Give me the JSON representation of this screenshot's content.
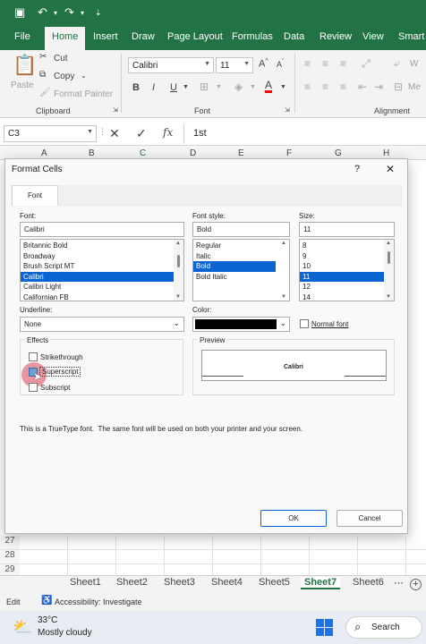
{
  "qat": {
    "save_icon": "save-icon",
    "undo_icon": "undo-icon",
    "redo_icon": "redo-icon"
  },
  "ribbon_tabs": [
    "File",
    "Home",
    "Insert",
    "Draw",
    "Page Layout",
    "Formulas",
    "Data",
    "Review",
    "View",
    "Smart W"
  ],
  "clipboard": {
    "paste": "Paste",
    "cut": "Cut",
    "copy": "Copy",
    "format_painter": "Format Painter",
    "group": "Clipboard"
  },
  "font_group": {
    "font_name": "Calibri",
    "font_size": "11",
    "bold": "B",
    "italic": "I",
    "underline": "U",
    "font_color_letter": "A",
    "group": "Font",
    "font_color": "#ff0000"
  },
  "alignment_group": {
    "wrap": "W",
    "merge": "Me",
    "group": "Alignment"
  },
  "formula_bar": {
    "name_box": "C3",
    "fx": "fx",
    "value": "1st"
  },
  "columns": [
    "A",
    "B",
    "C",
    "D",
    "E",
    "F",
    "G",
    "H"
  ],
  "rows": [
    "27",
    "28",
    "29"
  ],
  "dialog": {
    "title": "Format Cells",
    "help": "?",
    "close": "✕",
    "tab": "Font",
    "font_label": "Font:",
    "font_value": "Calibri",
    "font_list": [
      "Britannic Bold",
      "Broadway",
      "Brush Script MT",
      "Calibri",
      "Calibri Light",
      "Californian FB"
    ],
    "font_selected": "Calibri",
    "style_label": "Font style:",
    "style_value": "Bold",
    "style_list": [
      "Regular",
      "Italic",
      "Bold",
      "Bold Italic"
    ],
    "style_selected": "Bold",
    "size_label": "Size:",
    "size_value": "11",
    "size_list": [
      "8",
      "9",
      "10",
      "11",
      "12",
      "14"
    ],
    "size_selected": "11",
    "underline_label": "Underline:",
    "underline_value": "None",
    "color_label": "Color:",
    "color_value": "#000000",
    "normal_font": "Normal font",
    "effects_label": "Effects",
    "strikethrough": "Strikethrough",
    "superscript": "Superscript",
    "subscript": "Subscript",
    "superscript_checked": true,
    "preview_label": "Preview",
    "preview_text": "Calibri",
    "info": "This is a TrueType font.  The same font will be used on both your printer and your screen.",
    "ok": "OK",
    "cancel": "Cancel"
  },
  "sheet_tabs": [
    "Sheet1",
    "Sheet2",
    "Sheet3",
    "Sheet4",
    "Sheet5",
    "Sheet7",
    "Sheet6"
  ],
  "active_sheet": "Sheet7",
  "status": {
    "mode": "Edit",
    "accessibility": "Accessibility: Investigate"
  },
  "taskbar": {
    "temp": "33°C",
    "weather": "Mostly cloudy",
    "search": "Search"
  }
}
